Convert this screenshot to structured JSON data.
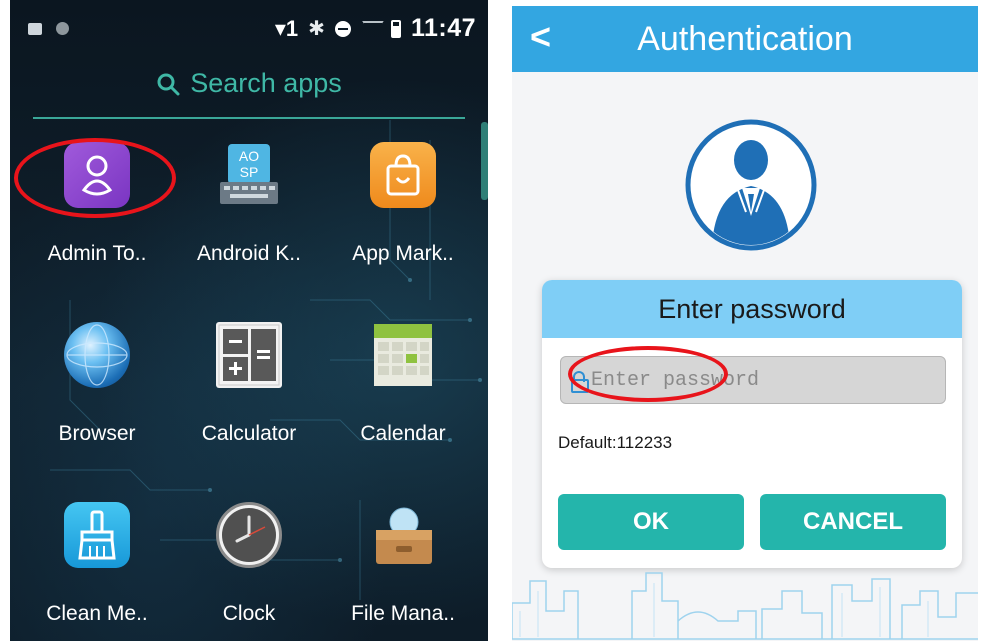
{
  "left_screen": {
    "status_bar": {
      "signal_text": "▾1",
      "time": "11:47"
    },
    "search": {
      "label": "Search apps"
    },
    "apps": [
      {
        "label": "Admin To..",
        "icon": "admin-tools-icon"
      },
      {
        "label": "Android K..",
        "icon": "aosp-keyboard-icon"
      },
      {
        "label": "App Mark..",
        "icon": "app-market-icon"
      },
      {
        "label": "Browser",
        "icon": "browser-globe-icon"
      },
      {
        "label": "Calculator",
        "icon": "calculator-icon"
      },
      {
        "label": "Calendar",
        "icon": "calendar-icon"
      },
      {
        "label": "Clean Me..",
        "icon": "clean-memory-icon"
      },
      {
        "label": "Clock",
        "icon": "clock-icon"
      },
      {
        "label": "File Mana..",
        "icon": "file-manager-icon"
      }
    ],
    "keyboard_icon_text": [
      "AO",
      "SP"
    ]
  },
  "right_screen": {
    "header": {
      "back_glyph": "<",
      "title": "Authentication"
    },
    "dialog": {
      "title": "Enter password",
      "password_placeholder": "Enter password",
      "default_hint": "Default:112233",
      "ok_label": "OK",
      "cancel_label": "CANCEL"
    }
  },
  "colors": {
    "header_blue": "#33a6e1",
    "dialog_head_blue": "#7fcef6",
    "button_teal": "#24b5ab",
    "search_teal": "#3fb8a6",
    "highlight_red": "#e8141b"
  }
}
